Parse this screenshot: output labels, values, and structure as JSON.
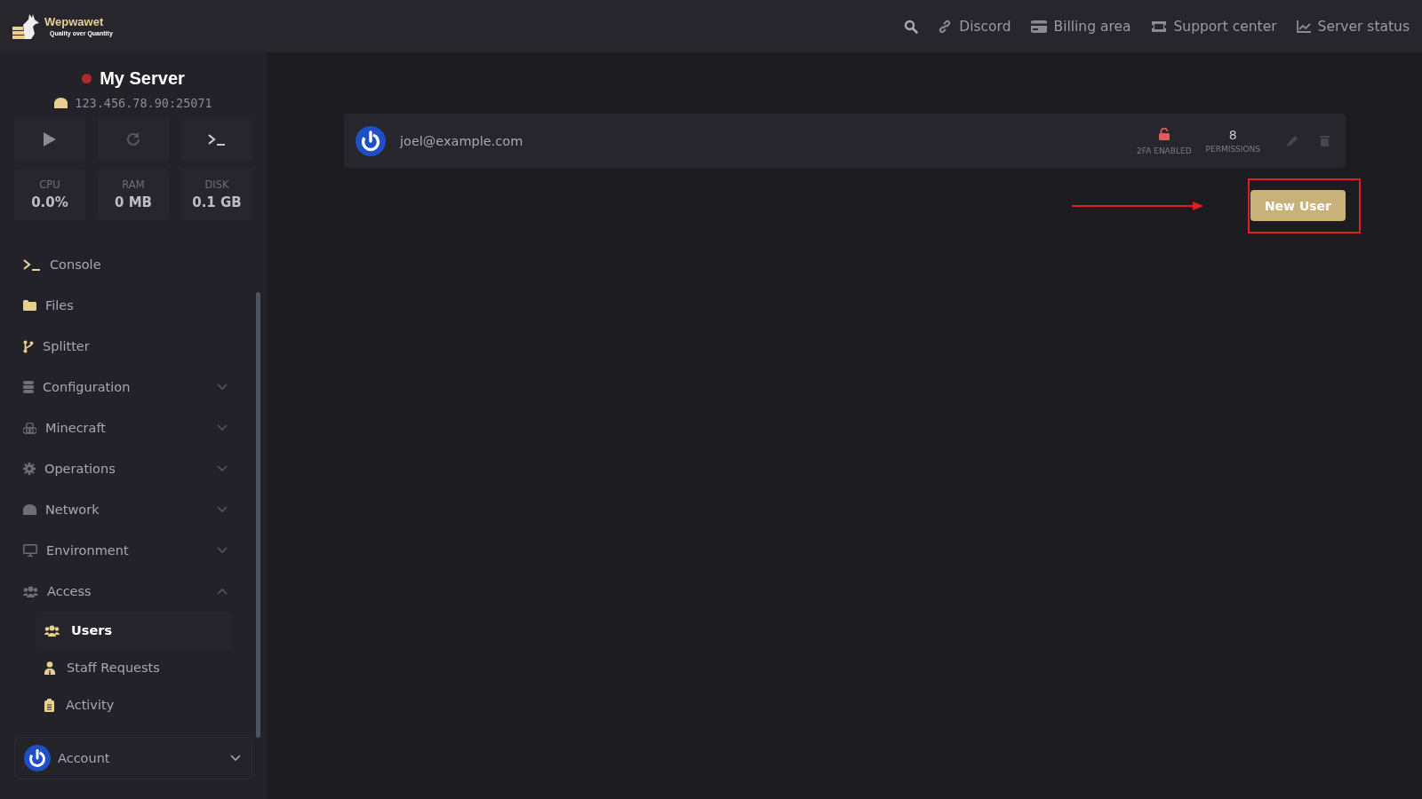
{
  "logo": {
    "name": "Wepwawet",
    "tagline": "Quality over Quantity"
  },
  "nav_links": [
    {
      "label": "Discord"
    },
    {
      "label": "Billing area"
    },
    {
      "label": "Support center"
    },
    {
      "label": "Server status"
    }
  ],
  "server": {
    "name": "My Server",
    "online": false,
    "address": "123.456.78.90:25071"
  },
  "stats": [
    {
      "label": "CPU",
      "value": "0.0%"
    },
    {
      "label": "RAM",
      "value": "0 MB"
    },
    {
      "label": "DISK",
      "value": "0.1 GB"
    }
  ],
  "sidebar": {
    "items": [
      {
        "label": "Console",
        "kind": "link"
      },
      {
        "label": "Files",
        "kind": "link"
      },
      {
        "label": "Splitter",
        "kind": "link"
      },
      {
        "label": "Configuration",
        "kind": "group",
        "expanded": false
      },
      {
        "label": "Minecraft",
        "kind": "group",
        "expanded": false
      },
      {
        "label": "Operations",
        "kind": "group",
        "expanded": false
      },
      {
        "label": "Network",
        "kind": "group",
        "expanded": false
      },
      {
        "label": "Environment",
        "kind": "group",
        "expanded": false
      },
      {
        "label": "Access",
        "kind": "group",
        "expanded": true,
        "children": [
          {
            "label": "Users",
            "selected": true
          },
          {
            "label": "Staff Requests",
            "selected": false
          },
          {
            "label": "Activity",
            "selected": false
          }
        ]
      }
    ]
  },
  "account": {
    "label": "Account"
  },
  "users": [
    {
      "email": "joel@example.com",
      "two_fa_enabled": false,
      "two_fa_label": "2FA ENABLED",
      "permissions": "8",
      "permissions_label": "PERMISSIONS"
    }
  ],
  "new_user_button": {
    "label": "New User"
  }
}
